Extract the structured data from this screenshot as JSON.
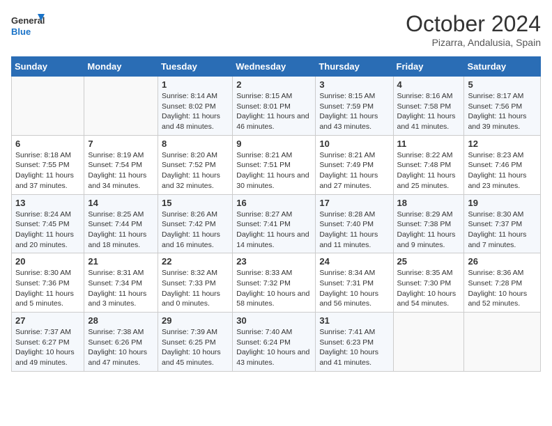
{
  "logo": {
    "line1": "General",
    "line2": "Blue"
  },
  "title": "October 2024",
  "subtitle": "Pizarra, Andalusia, Spain",
  "days_of_week": [
    "Sunday",
    "Monday",
    "Tuesday",
    "Wednesday",
    "Thursday",
    "Friday",
    "Saturday"
  ],
  "weeks": [
    [
      {
        "day": "",
        "info": ""
      },
      {
        "day": "",
        "info": ""
      },
      {
        "day": "1",
        "info": "Sunrise: 8:14 AM\nSunset: 8:02 PM\nDaylight: 11 hours and 48 minutes."
      },
      {
        "day": "2",
        "info": "Sunrise: 8:15 AM\nSunset: 8:01 PM\nDaylight: 11 hours and 46 minutes."
      },
      {
        "day": "3",
        "info": "Sunrise: 8:15 AM\nSunset: 7:59 PM\nDaylight: 11 hours and 43 minutes."
      },
      {
        "day": "4",
        "info": "Sunrise: 8:16 AM\nSunset: 7:58 PM\nDaylight: 11 hours and 41 minutes."
      },
      {
        "day": "5",
        "info": "Sunrise: 8:17 AM\nSunset: 7:56 PM\nDaylight: 11 hours and 39 minutes."
      }
    ],
    [
      {
        "day": "6",
        "info": "Sunrise: 8:18 AM\nSunset: 7:55 PM\nDaylight: 11 hours and 37 minutes."
      },
      {
        "day": "7",
        "info": "Sunrise: 8:19 AM\nSunset: 7:54 PM\nDaylight: 11 hours and 34 minutes."
      },
      {
        "day": "8",
        "info": "Sunrise: 8:20 AM\nSunset: 7:52 PM\nDaylight: 11 hours and 32 minutes."
      },
      {
        "day": "9",
        "info": "Sunrise: 8:21 AM\nSunset: 7:51 PM\nDaylight: 11 hours and 30 minutes."
      },
      {
        "day": "10",
        "info": "Sunrise: 8:21 AM\nSunset: 7:49 PM\nDaylight: 11 hours and 27 minutes."
      },
      {
        "day": "11",
        "info": "Sunrise: 8:22 AM\nSunset: 7:48 PM\nDaylight: 11 hours and 25 minutes."
      },
      {
        "day": "12",
        "info": "Sunrise: 8:23 AM\nSunset: 7:46 PM\nDaylight: 11 hours and 23 minutes."
      }
    ],
    [
      {
        "day": "13",
        "info": "Sunrise: 8:24 AM\nSunset: 7:45 PM\nDaylight: 11 hours and 20 minutes."
      },
      {
        "day": "14",
        "info": "Sunrise: 8:25 AM\nSunset: 7:44 PM\nDaylight: 11 hours and 18 minutes."
      },
      {
        "day": "15",
        "info": "Sunrise: 8:26 AM\nSunset: 7:42 PM\nDaylight: 11 hours and 16 minutes."
      },
      {
        "day": "16",
        "info": "Sunrise: 8:27 AM\nSunset: 7:41 PM\nDaylight: 11 hours and 14 minutes."
      },
      {
        "day": "17",
        "info": "Sunrise: 8:28 AM\nSunset: 7:40 PM\nDaylight: 11 hours and 11 minutes."
      },
      {
        "day": "18",
        "info": "Sunrise: 8:29 AM\nSunset: 7:38 PM\nDaylight: 11 hours and 9 minutes."
      },
      {
        "day": "19",
        "info": "Sunrise: 8:30 AM\nSunset: 7:37 PM\nDaylight: 11 hours and 7 minutes."
      }
    ],
    [
      {
        "day": "20",
        "info": "Sunrise: 8:30 AM\nSunset: 7:36 PM\nDaylight: 11 hours and 5 minutes."
      },
      {
        "day": "21",
        "info": "Sunrise: 8:31 AM\nSunset: 7:34 PM\nDaylight: 11 hours and 3 minutes."
      },
      {
        "day": "22",
        "info": "Sunrise: 8:32 AM\nSunset: 7:33 PM\nDaylight: 11 hours and 0 minutes."
      },
      {
        "day": "23",
        "info": "Sunrise: 8:33 AM\nSunset: 7:32 PM\nDaylight: 10 hours and 58 minutes."
      },
      {
        "day": "24",
        "info": "Sunrise: 8:34 AM\nSunset: 7:31 PM\nDaylight: 10 hours and 56 minutes."
      },
      {
        "day": "25",
        "info": "Sunrise: 8:35 AM\nSunset: 7:30 PM\nDaylight: 10 hours and 54 minutes."
      },
      {
        "day": "26",
        "info": "Sunrise: 8:36 AM\nSunset: 7:28 PM\nDaylight: 10 hours and 52 minutes."
      }
    ],
    [
      {
        "day": "27",
        "info": "Sunrise: 7:37 AM\nSunset: 6:27 PM\nDaylight: 10 hours and 49 minutes."
      },
      {
        "day": "28",
        "info": "Sunrise: 7:38 AM\nSunset: 6:26 PM\nDaylight: 10 hours and 47 minutes."
      },
      {
        "day": "29",
        "info": "Sunrise: 7:39 AM\nSunset: 6:25 PM\nDaylight: 10 hours and 45 minutes."
      },
      {
        "day": "30",
        "info": "Sunrise: 7:40 AM\nSunset: 6:24 PM\nDaylight: 10 hours and 43 minutes."
      },
      {
        "day": "31",
        "info": "Sunrise: 7:41 AM\nSunset: 6:23 PM\nDaylight: 10 hours and 41 minutes."
      },
      {
        "day": "",
        "info": ""
      },
      {
        "day": "",
        "info": ""
      }
    ]
  ]
}
